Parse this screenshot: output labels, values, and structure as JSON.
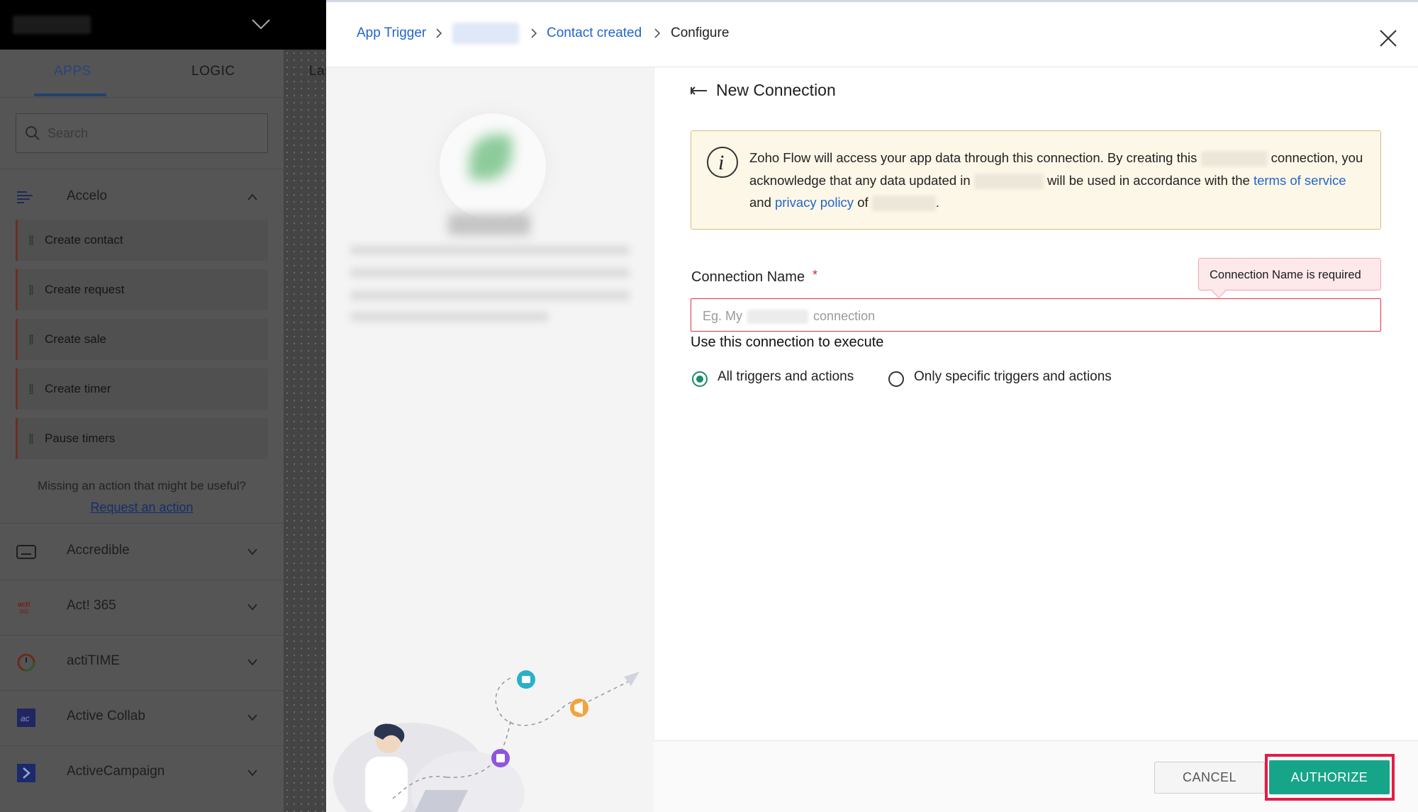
{
  "sidebar": {
    "tabs": [
      "APPS",
      "LOGIC",
      "Las"
    ],
    "search_placeholder": "Search",
    "expanded_app": "Accelo",
    "actions": [
      "Create contact",
      "Create request",
      "Create sale",
      "Create timer",
      "Pause timers"
    ],
    "missing_text": "Missing an action that might be useful?",
    "request_link": "Request an action",
    "apps": [
      "Accredible",
      "Act! 365",
      "actiTIME",
      "Active Collab",
      "ActiveCampaign"
    ]
  },
  "breadcrumb": {
    "items": [
      "App Trigger",
      "Contact created",
      "Configure"
    ]
  },
  "connection": {
    "title": "New Connection",
    "info": {
      "part1": "Zoho Flow will access your app data through this connection. By creating this",
      "part2": "connection, you acknowledge that any data updated in",
      "part3": "will be used in accordance with the",
      "terms_link": "terms of service",
      "and": "and",
      "privacy_link": "privacy policy",
      "of": "of",
      "end": "."
    },
    "name_label": "Connection Name",
    "required_mark": "*",
    "tooltip": "Connection Name is required",
    "placeholder_prefix": "Eg. My",
    "placeholder_suffix": "connection",
    "use_label": "Use this connection to execute",
    "options": [
      "All triggers and actions",
      "Only specific triggers and actions"
    ],
    "selected_option": "All triggers and actions"
  },
  "footer": {
    "cancel": "CANCEL",
    "authorize": "AUTHORIZE"
  },
  "colors": {
    "accent": "#17a589",
    "link": "#2266cc",
    "error": "#e0343d",
    "highlight": "#e11d48"
  }
}
